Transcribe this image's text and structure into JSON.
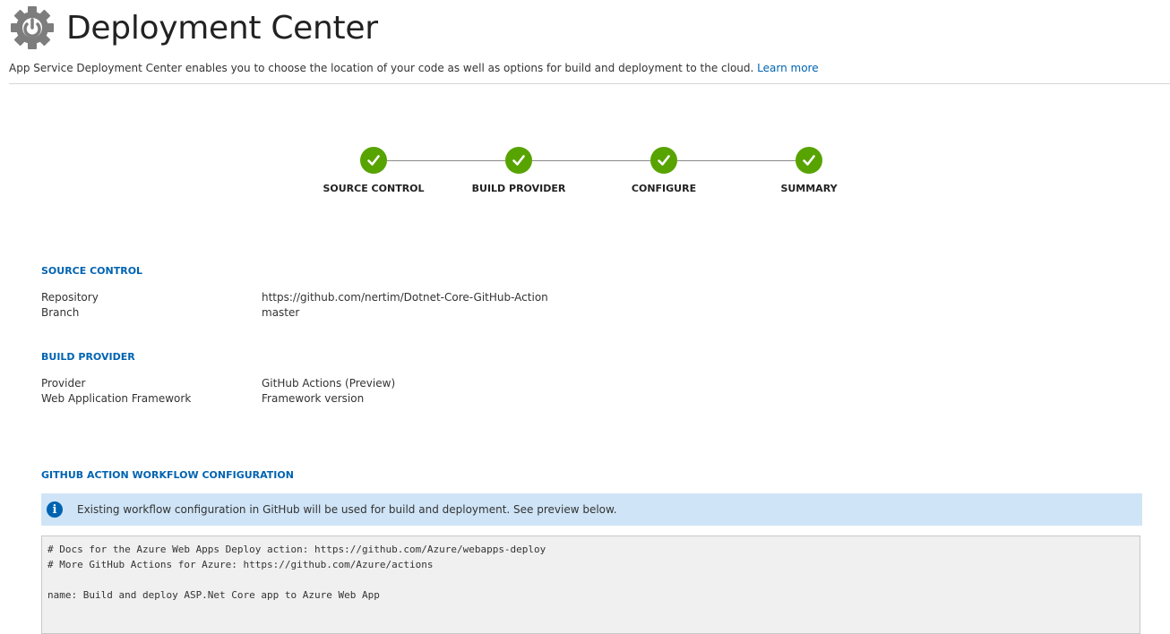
{
  "header": {
    "title": "Deployment Center",
    "icon": "gear-icon",
    "description": "App Service Deployment Center enables you to choose the location of your code as well as options for build and deployment to the cloud.",
    "learn_more": "Learn more"
  },
  "steps": [
    {
      "label": "SOURCE CONTROL",
      "status": "complete",
      "icon": "checkmark-icon"
    },
    {
      "label": "BUILD PROVIDER",
      "status": "complete",
      "icon": "checkmark-icon"
    },
    {
      "label": "CONFIGURE",
      "status": "complete",
      "icon": "checkmark-icon"
    },
    {
      "label": "SUMMARY",
      "status": "complete",
      "icon": "checkmark-icon"
    }
  ],
  "source_control": {
    "title": "SOURCE CONTROL",
    "rows": [
      {
        "label": "Repository",
        "value": "https://github.com/nertim/Dotnet-Core-GitHub-Action"
      },
      {
        "label": "Branch",
        "value": "master"
      }
    ]
  },
  "build_provider": {
    "title": "BUILD PROVIDER",
    "rows": [
      {
        "label": "Provider",
        "value": "GitHub Actions (Preview)"
      },
      {
        "label": "Web Application Framework",
        "value": "Framework version"
      }
    ]
  },
  "workflow": {
    "title": "GITHUB ACTION WORKFLOW CONFIGURATION",
    "info_icon": "info-icon",
    "info_text": "Existing workflow configuration in GitHub will be used for build and deployment. See preview below.",
    "code_lines": [
      "# Docs for the Azure Web Apps Deploy action: https://github.com/Azure/webapps-deploy",
      "# More GitHub Actions for Azure: https://github.com/Azure/actions",
      "",
      "name: Build and deploy ASP.Net Core app to Azure Web App"
    ]
  },
  "colors": {
    "accent": "#0063b1",
    "step_complete": "#57a300",
    "info_bg": "#cfe4f6"
  }
}
